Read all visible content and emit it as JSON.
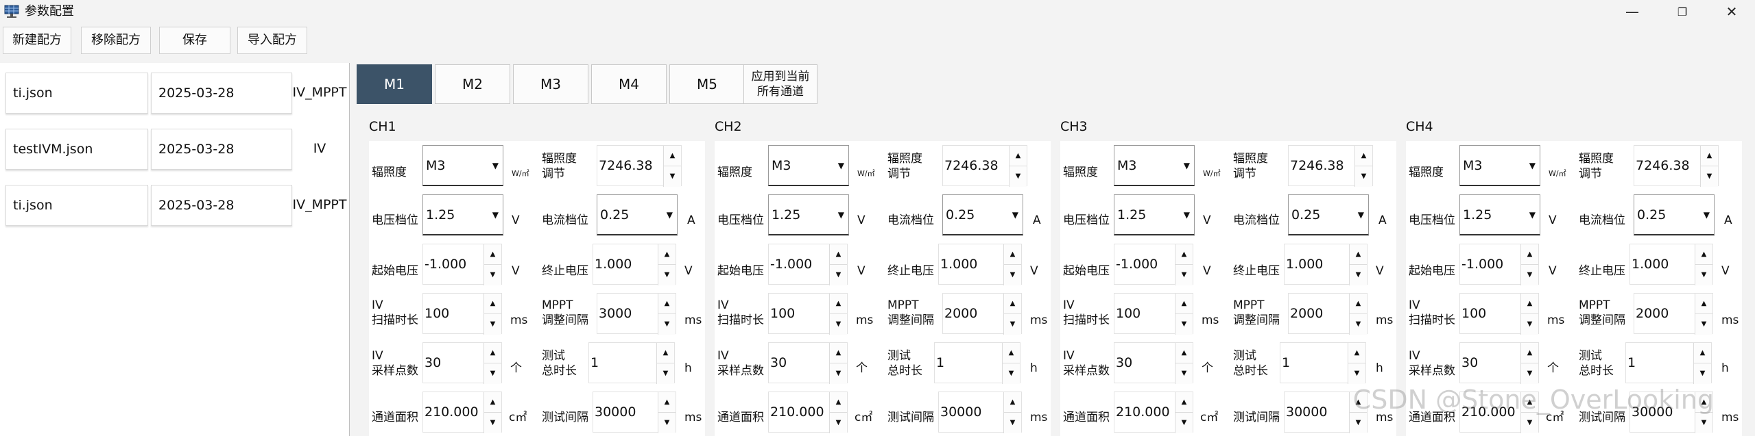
{
  "window": {
    "title": "参数配置",
    "minimize": "—",
    "maximize": "❐",
    "close": "✕"
  },
  "toolbar": {
    "new": "新建配方",
    "remove": "移除配方",
    "save": "保存",
    "import": "导入配方"
  },
  "recipes": [
    {
      "name": "ti.json",
      "date": "2025-03-28",
      "type": "IV_MPPT"
    },
    {
      "name": "testIVM.json",
      "date": "2025-03-28",
      "type": "IV"
    },
    {
      "name": "ti.json",
      "date": "2025-03-28",
      "type": "IV_MPPT"
    }
  ],
  "module_tabs": [
    "M1",
    "M2",
    "M3",
    "M4",
    "M5"
  ],
  "active_tab": "M1",
  "apply_button": {
    "line1": "应用到当前",
    "line2": "所有通道"
  },
  "labels": {
    "irradiance": "辐照度",
    "irr_adjust_1": "辐照度",
    "irr_adjust_2": "调节",
    "voltage_range": "电压档位",
    "current_range": "电流档位",
    "start_v": "起始电压",
    "end_v": "终止电压",
    "iv_scan_1": "IV",
    "iv_scan_2": "扫描时长",
    "mppt_1": "MPPT",
    "mppt_2": "调整间隔",
    "iv_points_1": "IV",
    "iv_points_2": "采样点数",
    "total_1": "测试",
    "total_2": "总时长",
    "area": "通道面积",
    "interval": "测试间隔"
  },
  "units": {
    "irr": "W/㎡",
    "v": "V",
    "a": "A",
    "ms": "ms",
    "count": "个",
    "h": "h",
    "area": "c㎡"
  },
  "channels": [
    {
      "title": "CH1",
      "irr": "M3",
      "irr_adj": "7246.38",
      "v_range": "1.25",
      "i_range": "0.25",
      "start_v": "-1.000",
      "end_v": "1.000",
      "scan": "100",
      "mppt": "3000",
      "points": "30",
      "total": "1",
      "area": "210.000",
      "interval": "30000"
    },
    {
      "title": "CH2",
      "irr": "M3",
      "irr_adj": "7246.38",
      "v_range": "1.25",
      "i_range": "0.25",
      "start_v": "-1.000",
      "end_v": "1.000",
      "scan": "100",
      "mppt": "2000",
      "points": "30",
      "total": "1",
      "area": "210.000",
      "interval": "30000"
    },
    {
      "title": "CH3",
      "irr": "M3",
      "irr_adj": "7246.38",
      "v_range": "1.25",
      "i_range": "0.25",
      "start_v": "-1.000",
      "end_v": "1.000",
      "scan": "100",
      "mppt": "2000",
      "points": "30",
      "total": "1",
      "area": "210.000",
      "interval": "30000"
    },
    {
      "title": "CH4",
      "irr": "M3",
      "irr_adj": "7246.38",
      "v_range": "1.25",
      "i_range": "0.25",
      "start_v": "-1.000",
      "end_v": "1.000",
      "scan": "100",
      "mppt": "2000",
      "points": "30",
      "total": "1",
      "area": "210.000",
      "interval": "30000"
    }
  ],
  "watermark": "CSDN @Stone_OverLooking"
}
